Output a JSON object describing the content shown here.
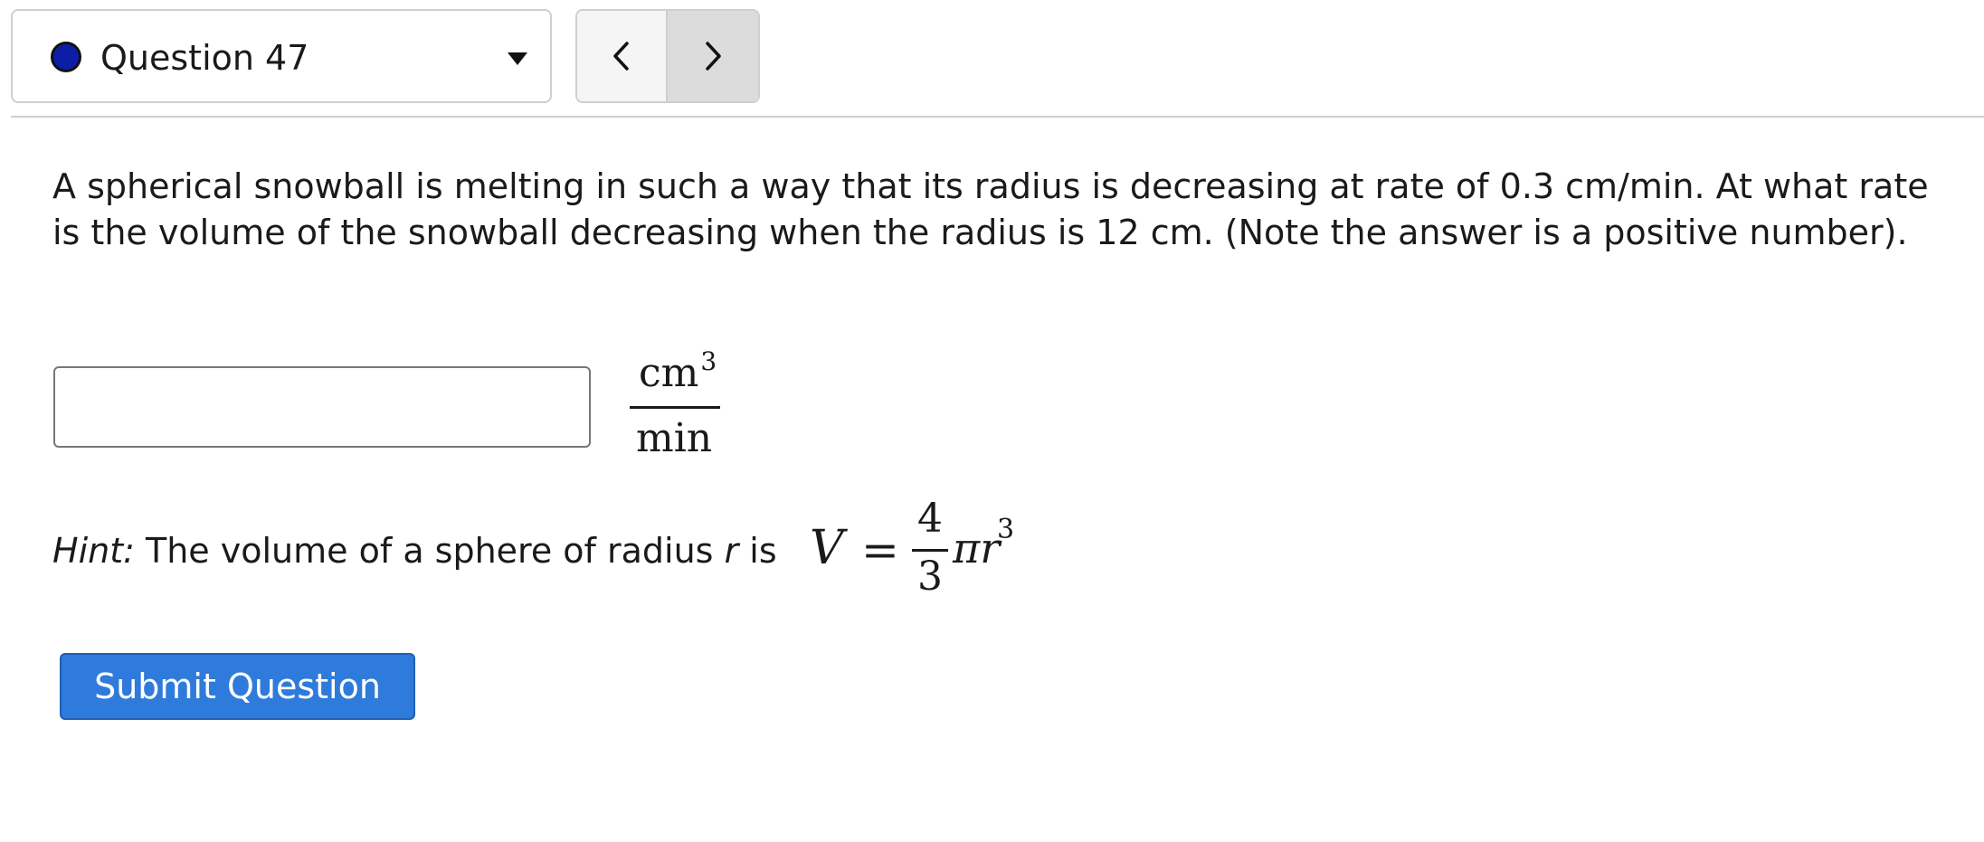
{
  "question_nav": {
    "status_icon": "status-dot-icon",
    "label": "Question 47",
    "dropdown_icon": "caret-down-icon",
    "prev_icon": "chevron-left-icon",
    "next_icon": "chevron-right-icon"
  },
  "question": {
    "text": "A spherical snowball is melting in such a way that its radius is decreasing at rate of 0.3 cm/min. At what rate is the volume of the snowball decreasing when the radius is 12 cm. (Note the answer is a positive number).",
    "answer_value": "",
    "unit_numerator": "cm",
    "unit_numerator_exponent": "3",
    "unit_denominator": "min"
  },
  "hint": {
    "label": "Hint:",
    "text_before_var": " The volume of a sphere of radius ",
    "variable": "r",
    "text_after_var": " is ",
    "formula_lhs": "V",
    "formula_eq": "=",
    "formula_num": "4",
    "formula_den": "3",
    "formula_tail": "πr",
    "formula_exponent": "3"
  },
  "actions": {
    "submit_label": "Submit Question"
  },
  "colors": {
    "status_dot": "#0d1ea6",
    "submit_bg": "#2f7bdb"
  }
}
